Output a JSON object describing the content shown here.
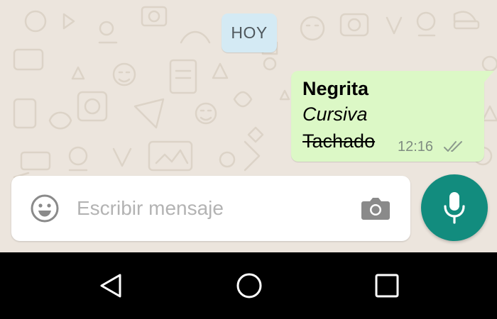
{
  "colors": {
    "chat_background": "#ece5dd",
    "outgoing_bubble": "#dcf8c6",
    "date_chip": "#d4eaf4",
    "accent": "#128c7e",
    "nav_bar": "#000000"
  },
  "chat": {
    "date_separator": "HOY",
    "message": {
      "bold_text": "Negrita",
      "italic_text": "Cursiva",
      "strikethrough_text": "Tachado",
      "time": "12:16",
      "status_icon": "double-check-icon"
    }
  },
  "composer": {
    "placeholder": "Escribir mensaje",
    "emoji_icon": "emoji-icon",
    "camera_icon": "camera-icon",
    "mic_icon": "microphone-icon"
  },
  "navigation": {
    "back_icon": "back-triangle-icon",
    "home_icon": "home-circle-icon",
    "recents_icon": "recents-square-icon"
  }
}
